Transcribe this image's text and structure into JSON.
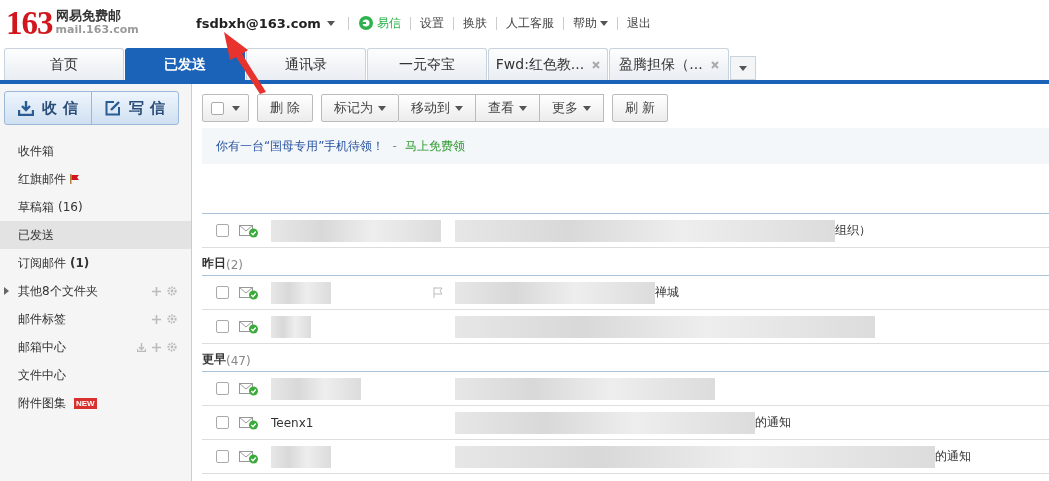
{
  "logo": {
    "number": "163",
    "name": "网易免费邮",
    "domain": "mail.163.com"
  },
  "account": "fsdbxh@163.com",
  "top_links": [
    {
      "label": "易信",
      "kind": "yixin"
    },
    {
      "label": "设置",
      "kind": "plain"
    },
    {
      "label": "换肤",
      "kind": "plain"
    },
    {
      "label": "人工客服",
      "kind": "plain"
    },
    {
      "label": "帮助",
      "kind": "menu"
    },
    {
      "label": "退出",
      "kind": "plain"
    }
  ],
  "tabs": [
    {
      "label": "首页",
      "selected": false,
      "closable": false
    },
    {
      "label": "已发送",
      "selected": true,
      "closable": false
    },
    {
      "label": "通讯录",
      "selected": false,
      "closable": false
    },
    {
      "label": "一元夺宝",
      "selected": false,
      "closable": false
    },
    {
      "label": "Fwd:红色教...",
      "selected": false,
      "closable": true
    },
    {
      "label": "盈腾担保（...",
      "selected": false,
      "closable": true
    }
  ],
  "compose_buttons": [
    {
      "label": "收 信",
      "kind": "receive"
    },
    {
      "label": "写 信",
      "kind": "write"
    }
  ],
  "sidebar": {
    "items": [
      {
        "label": "收件箱",
        "selected": false,
        "kind": "folder"
      },
      {
        "label": "红旗邮件",
        "selected": false,
        "kind": "flagged"
      },
      {
        "label": "草稿箱",
        "count": "(16)",
        "count_bold": false,
        "selected": false,
        "kind": "folder"
      },
      {
        "label": "已发送",
        "selected": true,
        "kind": "folder"
      },
      {
        "label": "订阅邮件",
        "count": "(1)",
        "count_bold": true,
        "selected": false,
        "kind": "folder"
      },
      {
        "label": "其他8个文件夹",
        "selected": false,
        "kind": "group",
        "actions": [
          {
            "kind": "add"
          },
          {
            "kind": "settings"
          }
        ]
      },
      {
        "label": "邮件标签",
        "selected": false,
        "kind": "folder",
        "actions": [
          {
            "kind": "add"
          },
          {
            "kind": "settings"
          }
        ]
      },
      {
        "label": "邮箱中心",
        "selected": false,
        "kind": "folder",
        "actions": [
          {
            "kind": "download"
          },
          {
            "kind": "add"
          },
          {
            "kind": "settings"
          }
        ]
      },
      {
        "label": "文件中心",
        "selected": false,
        "kind": "folder"
      },
      {
        "label": "附件图集",
        "badge": "NEW",
        "selected": false,
        "kind": "folder"
      }
    ]
  },
  "toolbar": {
    "select_all": {
      "checked": false
    },
    "groups": [
      [
        {
          "label": "删 除",
          "menu": false
        }
      ],
      [
        {
          "label": "标记为",
          "menu": true
        },
        {
          "label": "移动到",
          "menu": true
        },
        {
          "label": "查看",
          "menu": true
        },
        {
          "label": "更多",
          "menu": true
        }
      ],
      [
        {
          "label": "刷 新",
          "menu": false
        }
      ]
    ]
  },
  "banner": {
    "text": "你有一台“国母专用”手机待领！",
    "separator": "-",
    "link": "马上免费领"
  },
  "mail_groups": [
    {
      "rows": [
        {
          "checked": false,
          "subject": "组织）"
        }
      ]
    },
    {
      "title": "昨日",
      "count": "(2)",
      "rows": [
        {
          "checked": false,
          "flag_icon": true,
          "subject": "禅城"
        },
        {
          "checked": false
        }
      ]
    },
    {
      "title": "更早",
      "count": "(47)",
      "rows": [
        {
          "checked": false
        },
        {
          "checked": false,
          "sender": "Teenx1",
          "subject": "的通知"
        },
        {
          "checked": false,
          "subject": "的通知"
        }
      ]
    }
  ]
}
